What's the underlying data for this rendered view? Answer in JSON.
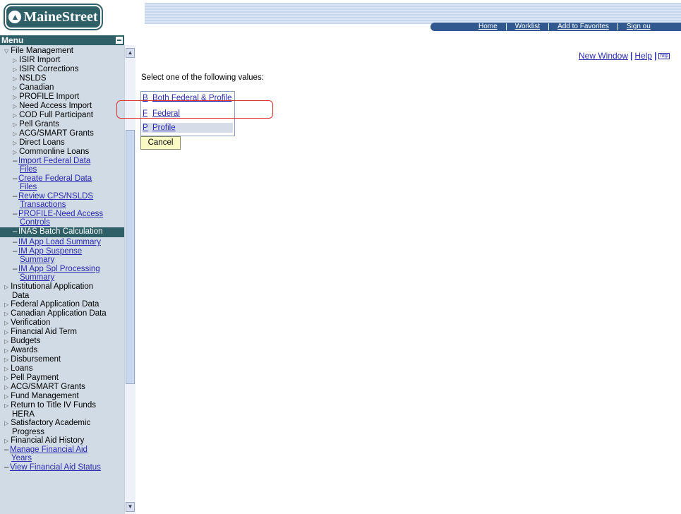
{
  "banner": {
    "logo_text": "MaineStreet",
    "nav": [
      "Home",
      "Worklist",
      "Add to Favorites",
      "Sign ou"
    ]
  },
  "menu": {
    "title": "Menu",
    "items": [
      {
        "label": "File Management",
        "type": "open",
        "indent": 1
      },
      {
        "label": "ISIR Import",
        "type": "folder",
        "indent": 2
      },
      {
        "label": "ISIR Corrections",
        "type": "folder",
        "indent": 2
      },
      {
        "label": "NSLDS",
        "type": "folder",
        "indent": 2
      },
      {
        "label": "Canadian",
        "type": "folder",
        "indent": 2
      },
      {
        "label": "PROFILE Import",
        "type": "folder",
        "indent": 2
      },
      {
        "label": "Need Access Import",
        "type": "folder",
        "indent": 2
      },
      {
        "label": "COD Full Participant",
        "type": "folder",
        "indent": 2
      },
      {
        "label": "Pell Grants",
        "type": "folder",
        "indent": 2
      },
      {
        "label": "ACG/SMART Grants",
        "type": "folder",
        "indent": 2
      },
      {
        "label": "Direct Loans",
        "type": "folder",
        "indent": 2
      },
      {
        "label": "Commonline Loans",
        "type": "folder",
        "indent": 2
      },
      {
        "label": "Import Federal Data",
        "label2": "Files",
        "type": "link",
        "indent": 2
      },
      {
        "label": "Create Federal Data",
        "label2": "Files",
        "type": "link",
        "indent": 2
      },
      {
        "label": "Review CPS/NSLDS",
        "label2": "Transactions",
        "type": "link",
        "indent": 2
      },
      {
        "label": "PROFILE-Need Access",
        "label2": "Controls",
        "type": "link",
        "indent": 2
      },
      {
        "label": "INAS Batch Calculation",
        "type": "selected",
        "indent": 2
      },
      {
        "label": "IM App Load Summary",
        "type": "link",
        "indent": 2
      },
      {
        "label": "IM App Suspense",
        "label2": "Summary",
        "type": "link",
        "indent": 2
      },
      {
        "label": "IM App Spl Processing",
        "label2": "Summary",
        "type": "link",
        "indent": 2
      },
      {
        "label": "Institutional Application",
        "label2": "Data",
        "type": "folder",
        "indent": 1
      },
      {
        "label": "Federal Application Data",
        "type": "folder",
        "indent": 1
      },
      {
        "label": "Canadian Application Data",
        "type": "folder",
        "indent": 1
      },
      {
        "label": "Verification",
        "type": "folder",
        "indent": 1
      },
      {
        "label": "Financial Aid Term",
        "type": "folder",
        "indent": 1
      },
      {
        "label": "Budgets",
        "type": "folder",
        "indent": 1
      },
      {
        "label": "Awards",
        "type": "folder",
        "indent": 1
      },
      {
        "label": "Disbursement",
        "type": "folder",
        "indent": 1
      },
      {
        "label": "Loans",
        "type": "folder",
        "indent": 1
      },
      {
        "label": "Pell Payment",
        "type": "folder",
        "indent": 1
      },
      {
        "label": "ACG/SMART Grants",
        "type": "folder",
        "indent": 1
      },
      {
        "label": "Fund Management",
        "type": "folder",
        "indent": 1
      },
      {
        "label": "Return to Title IV Funds",
        "label2": "HERA",
        "type": "folder",
        "indent": 1
      },
      {
        "label": "Satisfactory Academic",
        "label2": "Progress",
        "type": "folder",
        "indent": 1
      },
      {
        "label": "Financial Aid History",
        "type": "folder",
        "indent": 1
      },
      {
        "label": "Manage Financial Aid",
        "label2": "Years",
        "type": "link",
        "indent": 1
      },
      {
        "label": "View Financial Aid Status",
        "type": "link",
        "indent": 1
      }
    ]
  },
  "top_links": {
    "new_window": "New Window",
    "help": "Help",
    "http_icon_text": "http"
  },
  "lookup": {
    "prompt": "Select one of the following values:",
    "values": [
      {
        "code": "B",
        "description": "Both Federal & Profile"
      },
      {
        "code": "F",
        "description": "Federal"
      },
      {
        "code": "P",
        "description": "Profile"
      }
    ],
    "cancel_label": "Cancel"
  },
  "colors": {
    "accent": "#2f5f67",
    "nav_bar": "#31598f",
    "menu_bg": "#d1dbe5",
    "highlight": "#e03030"
  }
}
